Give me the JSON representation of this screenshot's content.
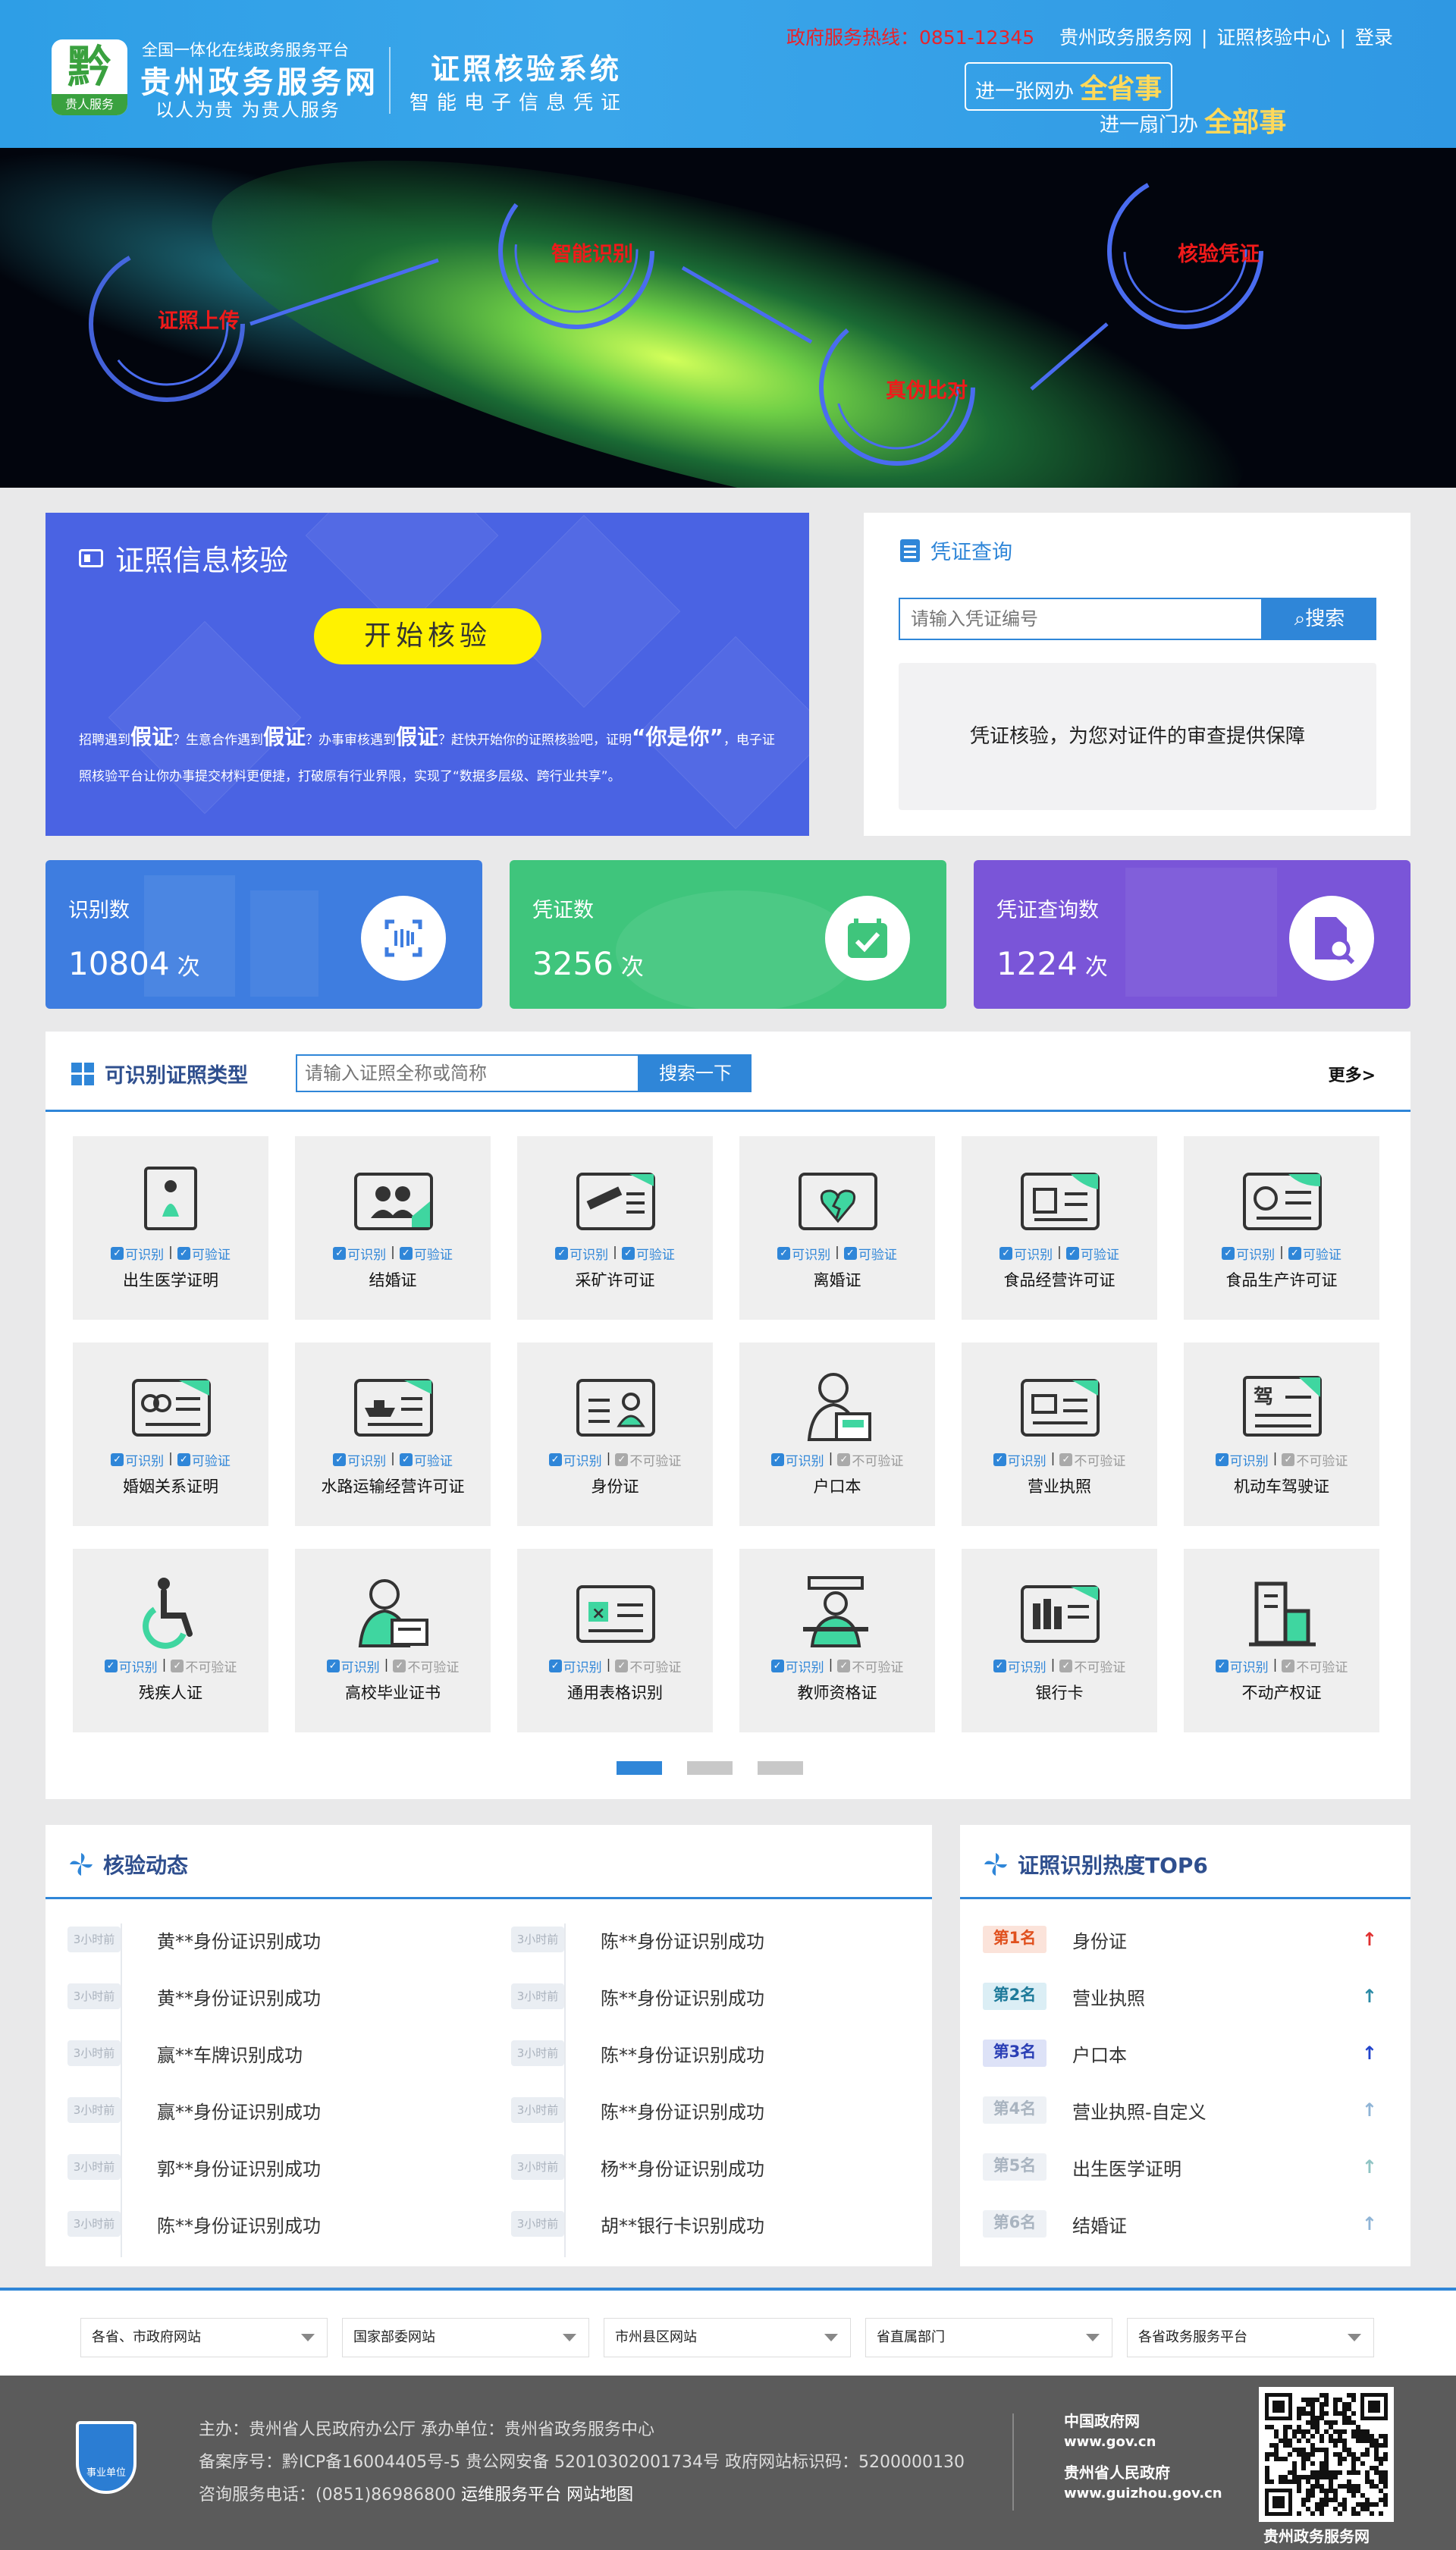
{
  "header": {
    "logo_label": "贵人服务",
    "site_sub": "全国一体化在线政务服务平台",
    "site_name": "贵州政务服务网",
    "site_slogan": "以人为贵  为贵人服务",
    "system_title": "证照核验系统",
    "system_sub": "智能电子信息凭证",
    "hotline": "政府服务热线：0851-12345",
    "links": [
      "贵州政务服务网",
      "证照核验中心",
      "登录"
    ],
    "slogan1_pre": "进一张网办",
    "slogan1_em": "全省事",
    "slogan2_pre": "进一扇门办",
    "slogan2_em": "全部事"
  },
  "banner": {
    "steps": [
      "证照上传",
      "智能识别",
      "真伪比对",
      "核验凭证"
    ]
  },
  "verify": {
    "title": "证照信息核验",
    "start_button": "开始核验",
    "desc_parts": [
      "招聘遇到",
      "假证",
      "？生意合作遇到",
      "假证",
      "？办事审核遇到",
      "假证",
      "？赶快开始你的证照核验吧，证明",
      "“你是你”",
      "，电子证照核验平台让你办事提交材料更便捷，打破原有行业界限，实现了“数据多层级、跨行业共享”。"
    ]
  },
  "query": {
    "title": "凭证查询",
    "placeholder": "请输入凭证编号",
    "search_button": "搜索",
    "note": "凭证核验，为您对证件的审查提供保障"
  },
  "stats": [
    {
      "label": "识别数",
      "value": "10804",
      "unit": "次",
      "color": "#3e7de0",
      "icon": "scan-icon"
    },
    {
      "label": "凭证数",
      "value": "3256",
      "unit": "次",
      "color": "#3fc57c",
      "icon": "check-icon"
    },
    {
      "label": "凭证查询数",
      "value": "1224",
      "unit": "次",
      "color": "#7a55d8",
      "icon": "doc-search-icon"
    }
  ],
  "types": {
    "title": "可识别证照类型",
    "placeholder": "请输入证照全称或简称",
    "search_button": "搜索一下",
    "more": "更多>",
    "flag_recognize": "可识别",
    "flag_verify": "可验证",
    "flag_no_verify": "不可验证",
    "items": [
      {
        "name": "出生医学证明",
        "verify": true,
        "icon": "birth"
      },
      {
        "name": "结婚证",
        "verify": true,
        "icon": "marriage"
      },
      {
        "name": "采矿许可证",
        "verify": true,
        "icon": "mining"
      },
      {
        "name": "离婚证",
        "verify": true,
        "icon": "divorce"
      },
      {
        "name": "食品经营许可证",
        "verify": true,
        "icon": "food"
      },
      {
        "name": "食品生产许可证",
        "verify": true,
        "icon": "foodprod"
      },
      {
        "name": "婚姻关系证明",
        "verify": true,
        "icon": "rings"
      },
      {
        "name": "水路运输经营许可证",
        "verify": true,
        "icon": "ship"
      },
      {
        "name": "身份证",
        "verify": false,
        "icon": "idcard"
      },
      {
        "name": "户口本",
        "verify": false,
        "icon": "household"
      },
      {
        "name": "营业执照",
        "verify": false,
        "icon": "license"
      },
      {
        "name": "机动车驾驶证",
        "verify": false,
        "icon": "driver"
      },
      {
        "name": "残疾人证",
        "verify": false,
        "icon": "disabled"
      },
      {
        "name": "高校毕业证书",
        "verify": false,
        "icon": "graduate"
      },
      {
        "name": "通用表格识别",
        "verify": false,
        "icon": "table"
      },
      {
        "name": "教师资格证",
        "verify": false,
        "icon": "teacher"
      },
      {
        "name": "银行卡",
        "verify": false,
        "icon": "bank"
      },
      {
        "name": "不动产权证",
        "verify": false,
        "icon": "property"
      }
    ],
    "active_page": 0,
    "pages": 3
  },
  "dynamics": {
    "title": "核验动态",
    "left": [
      {
        "time": "3小时前",
        "text": "黄**身份证识别成功"
      },
      {
        "time": "3小时前",
        "text": "黄**身份证识别成功"
      },
      {
        "time": "3小时前",
        "text": "赢**车牌识别成功"
      },
      {
        "time": "3小时前",
        "text": "赢**身份证识别成功"
      },
      {
        "time": "3小时前",
        "text": "郭**身份证识别成功"
      },
      {
        "time": "3小时前",
        "text": "陈**身份证识别成功"
      }
    ],
    "right": [
      {
        "time": "3小时前",
        "text": "陈**身份证识别成功"
      },
      {
        "time": "3小时前",
        "text": "陈**身份证识别成功"
      },
      {
        "time": "3小时前",
        "text": "陈**身份证识别成功"
      },
      {
        "time": "3小时前",
        "text": "陈**身份证识别成功"
      },
      {
        "time": "3小时前",
        "text": "杨**身份证识别成功"
      },
      {
        "time": "3小时前",
        "text": "胡**银行卡识别成功"
      }
    ]
  },
  "top6": {
    "title": "证照识别热度TOP6",
    "items": [
      {
        "rank": "第1名",
        "name": "身份证",
        "rank_color": "#e0501e",
        "rank_bg": "#fbe3da",
        "arrow_color": "#e03030"
      },
      {
        "rank": "第2名",
        "name": "营业执照",
        "rank_color": "#1e7a9a",
        "rank_bg": "#dbeef5",
        "arrow_color": "#2a8aa6"
      },
      {
        "rank": "第3名",
        "name": "户口本",
        "rank_color": "#2b3fb5",
        "rank_bg": "#dde2f7",
        "arrow_color": "#2244cc"
      },
      {
        "rank": "第4名",
        "name": "营业执照-自定义",
        "rank_color": "#a9b4c0",
        "rank_bg": "#eef1f5",
        "arrow_color": "#8fb4d6"
      },
      {
        "rank": "第5名",
        "name": "出生医学证明",
        "rank_color": "#a9b4c0",
        "rank_bg": "#eef1f5",
        "arrow_color": "#8fc4c4"
      },
      {
        "rank": "第6名",
        "name": "结婚证",
        "rank_color": "#a9b4c0",
        "rank_bg": "#eef1f5",
        "arrow_color": "#8fb4d6"
      }
    ]
  },
  "footer_links": [
    "各省、市政府网站",
    "国家部委网站",
    "市州县区网站",
    "省直属部门",
    "各省政务服务平台"
  ],
  "footer": {
    "badge": "事业单位",
    "line1": "主办：贵州省人民政府办公厅  承办单位：贵州省政务服务中心",
    "line2": "备案序号：黔ICP备16004405号-5 贵公网安备 52010302001734号 政府网站标识码：5200000130",
    "line3_pre": "咨询服务电话：(0851)86986800",
    "line3_links": [
      "运维服务平台",
      "网站地图"
    ],
    "gov1_name": "中国政府网",
    "gov1_url": "www.gov.cn",
    "gov2_name": "贵州省人民政府",
    "gov2_url": "www.guizhou.gov.cn",
    "qr_caption": "贵州政务服务网"
  }
}
